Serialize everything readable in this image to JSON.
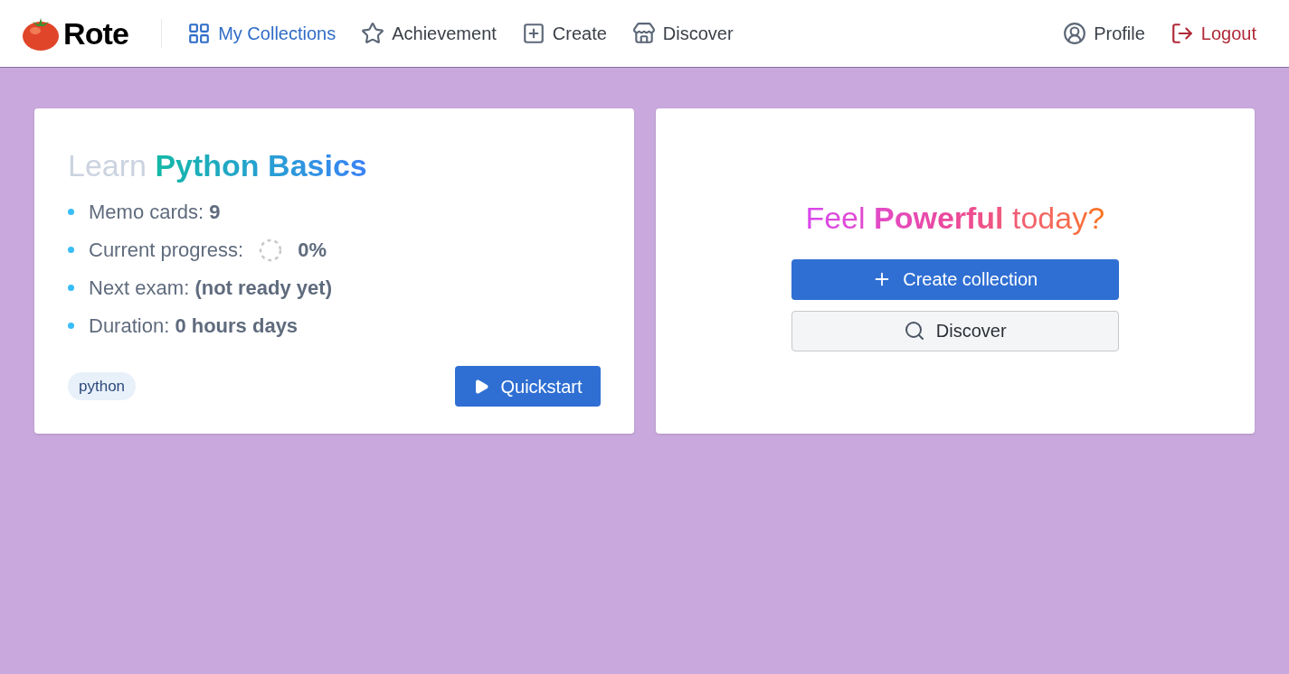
{
  "brand": {
    "name": "Rote"
  },
  "nav": [
    {
      "label": "My Collections",
      "selected": true
    },
    {
      "label": "Achievement",
      "selected": false
    },
    {
      "label": "Create",
      "selected": false
    },
    {
      "label": "Discover",
      "selected": false
    }
  ],
  "user_nav": [
    {
      "label": "Profile",
      "kind": "normal"
    },
    {
      "label": "Logout",
      "kind": "danger"
    }
  ],
  "collection_card": {
    "title_prefix": "Learn",
    "title_highlight": "Python Basics",
    "stats": [
      {
        "text": "Memo cards: **9**",
        "kind": "plain"
      },
      {
        "text": "Current progress:",
        "value": "0%",
        "kind": "progress"
      },
      {
        "text": "Next exam: **(not ready yet)**",
        "kind": "plain"
      },
      {
        "text": "Duration: **0 hours days**",
        "kind": "plain"
      }
    ],
    "tags": [
      "python"
    ],
    "button": "Quickstart"
  },
  "promo_card": {
    "prefix": "Feel",
    "highlight": "Powerful",
    "suffix": "today?",
    "buttons": [
      {
        "label": "Create collection",
        "kind": "primary"
      },
      {
        "label": "Discover",
        "kind": "secondary"
      }
    ]
  }
}
